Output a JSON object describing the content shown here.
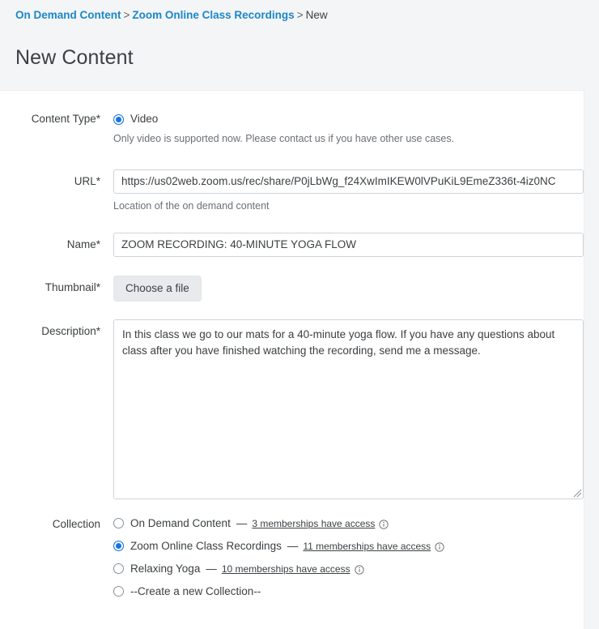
{
  "breadcrumb": {
    "items": [
      {
        "label": "On Demand Content",
        "type": "link"
      },
      {
        "label": "Zoom Online Class Recordings",
        "type": "link"
      },
      {
        "label": "New",
        "type": "current"
      }
    ],
    "separator": ">"
  },
  "page": {
    "title": "New Content"
  },
  "form": {
    "content_type": {
      "label": "Content Type*",
      "option_label": "Video",
      "selected": true,
      "help": "Only video is supported now. Please contact us if you have other use cases."
    },
    "url": {
      "label": "URL*",
      "value": "https://us02web.zoom.us/rec/share/P0jLbWg_f24XwImIKEW0lVPuKiL9EmeZ336t-4iz0NC",
      "help": "Location of the on demand content"
    },
    "name": {
      "label": "Name*",
      "value": "ZOOM RECORDING: 40-MINUTE YOGA FLOW"
    },
    "thumbnail": {
      "label": "Thumbnail*",
      "button_label": "Choose a file"
    },
    "description": {
      "label": "Description*",
      "value": "In this class we go to our mats for a 40-minute yoga flow. If you have any questions about class after you have finished watching the recording, send me a message."
    },
    "collection": {
      "label": "Collection",
      "dash": "—",
      "options": [
        {
          "name": "On Demand Content",
          "selected": false,
          "access": "3 memberships have access",
          "has_info": true
        },
        {
          "name": "Zoom Online Class Recordings",
          "selected": true,
          "access": "11 memberships have access",
          "has_info": true
        },
        {
          "name": "Relaxing Yoga",
          "selected": false,
          "access": "10 memberships have access",
          "has_info": true
        },
        {
          "name": "--Create a new Collection--",
          "selected": false,
          "access": "",
          "has_info": false
        }
      ]
    }
  },
  "colors": {
    "link": "#1a87c9",
    "accent": "#1673e6",
    "page_bg": "#f4f5f7",
    "card_bg": "#ffffff",
    "border": "#ced4da",
    "text": "#3c4043",
    "muted": "#6b7076"
  },
  "icons": {
    "info": "info-circle-icon"
  }
}
